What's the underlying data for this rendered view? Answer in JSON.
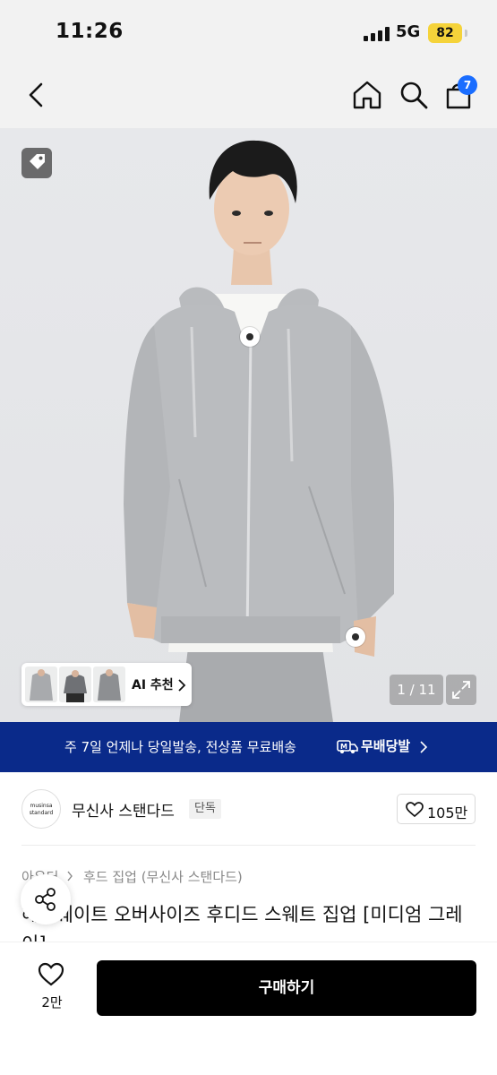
{
  "status_bar": {
    "time": "11:26",
    "network": "5G",
    "battery": "82"
  },
  "nav": {
    "cart_count": "7",
    "icons": [
      "back-icon",
      "home-icon",
      "search-icon",
      "cart-icon"
    ]
  },
  "product_image": {
    "ai_recommend_label": "AI 추천",
    "image_counter": "1 / 11"
  },
  "promo_banner": {
    "text": "주 7일 언제나 당일발송, 전상품 무료배송",
    "brand": "무배당발"
  },
  "brand": {
    "logo_text_1": "musinsa",
    "logo_text_2": "standard",
    "name": "무신사 스탠다드",
    "badge": "단독",
    "like_count": "105만"
  },
  "breadcrumb": {
    "level1": "아우터",
    "level2": "후드 집업 (무신사 스탠다드)"
  },
  "product": {
    "title": "헤비웨이트 오버사이즈 후디드 스웨트 집업 [미디엄 그레이]"
  },
  "bottom_bar": {
    "wish_count": "2만",
    "buy_label": "구매하기"
  },
  "colors": {
    "banner": "#0a2a8a",
    "badge": "#1a6dff",
    "battery": "#f5d33a",
    "buy_button": "#000000"
  }
}
